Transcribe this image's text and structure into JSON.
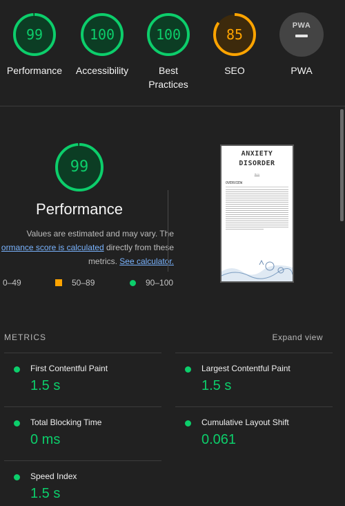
{
  "colors": {
    "pass": "#0cce6b",
    "average": "#ffa400",
    "background": "#212121"
  },
  "gauges": [
    {
      "score": "99",
      "label": "Performance",
      "status": "pass",
      "fraction": 0.99
    },
    {
      "score": "100",
      "label": "Accessibility",
      "status": "pass",
      "fraction": 1.0
    },
    {
      "score": "100",
      "label": "Best Practices",
      "status": "pass",
      "fraction": 1.0
    },
    {
      "score": "85",
      "label": "SEO",
      "status": "average",
      "fraction": 0.85
    },
    {
      "score": "",
      "label": "PWA",
      "status": "na",
      "logo": "PWA",
      "icon": "pwa-dash-icon"
    }
  ],
  "performance": {
    "score": "99",
    "fraction": 0.99,
    "title": "Performance",
    "desc_1": "Values are estimated and may vary. The",
    "desc_link": "ormance score is calculated",
    "desc_2": " directly from these",
    "desc_3": "metrics. ",
    "calc_link": "See calculator."
  },
  "legend": {
    "fail": "0–49",
    "average": "50–89",
    "pass": "90–100"
  },
  "thumbnail": {
    "title_1": "ANXIETY",
    "title_2": "DISORDER",
    "subtitle": "Menu",
    "section": "OVERVIEW"
  },
  "metrics": {
    "heading": "METRICS",
    "expand": "Expand view",
    "items": [
      {
        "name": "First Contentful Paint",
        "value": "1.5 s"
      },
      {
        "name": "Largest Contentful Paint",
        "value": "1.5 s"
      },
      {
        "name": "Total Blocking Time",
        "value": "0 ms"
      },
      {
        "name": "Cumulative Layout Shift",
        "value": "0.061"
      },
      {
        "name": "Speed Index",
        "value": "1.5 s"
      }
    ]
  }
}
